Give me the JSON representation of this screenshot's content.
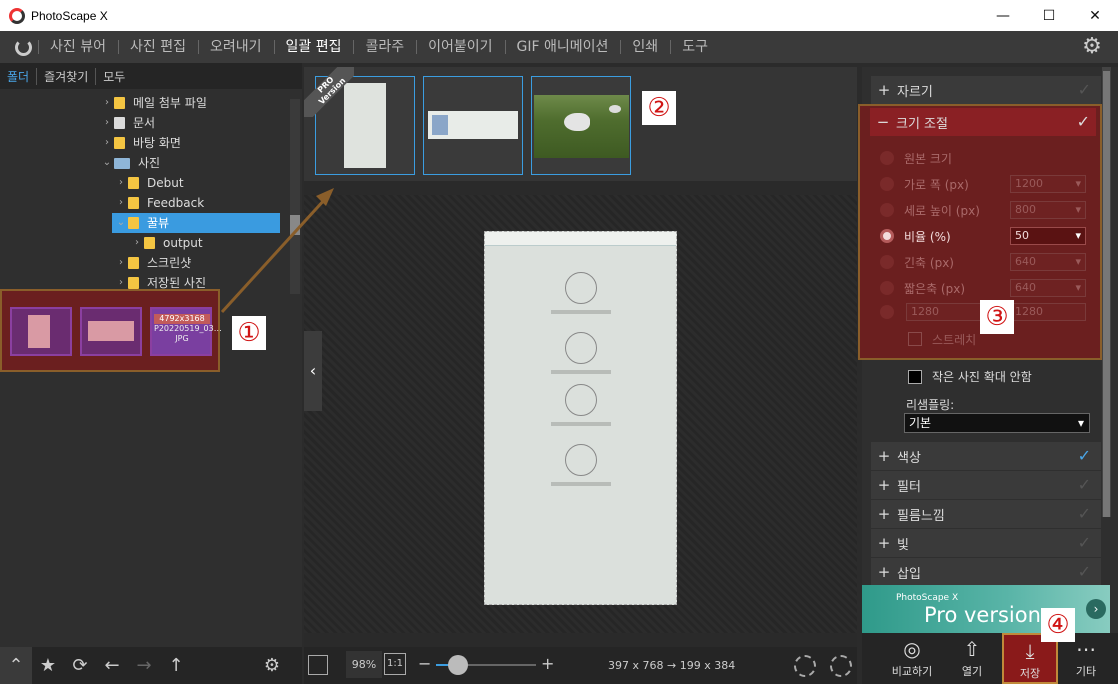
{
  "window": {
    "title": "PhotoScape X",
    "min": "—",
    "max": "☐",
    "close": "✕"
  },
  "menu": {
    "tabs": [
      "사진 뷰어",
      "사진 편집",
      "오려내기",
      "일괄 편집",
      "콜라주",
      "이어붙이기",
      "GIF 애니메이션",
      "인쇄",
      "도구"
    ],
    "active_index": 3
  },
  "left": {
    "subtabs": [
      "폴더",
      "즐겨찾기",
      "모두"
    ],
    "tree": [
      {
        "label": "메일 첨부 파일",
        "type": "folder",
        "level": 0,
        "arrow": "›"
      },
      {
        "label": "문서",
        "type": "doc",
        "level": 0,
        "arrow": "›"
      },
      {
        "label": "바탕 화면",
        "type": "folder",
        "level": 0,
        "arrow": "›"
      },
      {
        "label": "사진",
        "type": "pic",
        "level": 0,
        "arrow": "⌄"
      },
      {
        "label": "Debut",
        "type": "folder",
        "level": 1,
        "arrow": "›"
      },
      {
        "label": "Feedback",
        "type": "folder",
        "level": 1,
        "arrow": "›"
      },
      {
        "label": "꿀뷰",
        "type": "folder",
        "level": 1,
        "arrow": "⌄",
        "selected": true
      },
      {
        "label": "output",
        "type": "folder",
        "level": 2,
        "arrow": "›"
      },
      {
        "label": "스크린샷",
        "type": "folder",
        "level": 1,
        "arrow": "›"
      },
      {
        "label": "저장된 사진",
        "type": "folder",
        "level": 1,
        "arrow": "›"
      }
    ],
    "thumb3_dims": "4792x3168",
    "thumb3_name": "P20220519_03…JPG",
    "bottom_icons": [
      "chevron-up-icon",
      "star-icon",
      "sync-icon",
      "arrow-left-icon",
      "arrow-right-icon",
      "arrow-up-icon",
      "gear-icon"
    ]
  },
  "annotations": {
    "one": "①",
    "two": "②",
    "three": "③",
    "four": "④"
  },
  "center": {
    "pro_ribbon_line1": "PRO",
    "pro_ribbon_line2": "Version",
    "zoom": "98%",
    "one_to_one": "1:1",
    "zoom_minus": "−",
    "zoom_plus": "+",
    "zoom_fraction": 0.22,
    "dimensions": "397 x 768 → 199 x 384",
    "collapse_arrow": "‹"
  },
  "right": {
    "sections_top": [
      {
        "label": "자르기",
        "sign": "+",
        "checked": false
      }
    ],
    "resize": {
      "label": "크기 조절",
      "sign": "−",
      "options": [
        {
          "label": "원본 크기",
          "selected": false,
          "value": ""
        },
        {
          "label": "가로 폭 (px)",
          "selected": false,
          "value": "1200"
        },
        {
          "label": "세로 높이 (px)",
          "selected": false,
          "value": "800"
        },
        {
          "label": "비율 (%)",
          "selected": true,
          "value": "50"
        },
        {
          "label": "긴축 (px)",
          "selected": false,
          "value": "640"
        },
        {
          "label": "짧은축 (px)",
          "selected": false,
          "value": "640"
        }
      ],
      "custom_w": "1280",
      "custom_h": "1280",
      "stretch_label": "스트레치"
    },
    "no_upscale_label": "작은 사진 확대 안함",
    "resample_label": "리샘플링:",
    "resample_value": "기본",
    "sections_bottom": [
      {
        "label": "색상",
        "sign": "+",
        "checked": true
      },
      {
        "label": "필터",
        "sign": "+",
        "checked": false
      },
      {
        "label": "필름느낌",
        "sign": "+",
        "checked": false
      },
      {
        "label": "빛",
        "sign": "+",
        "checked": false
      },
      {
        "label": "삽입",
        "sign": "+",
        "checked": false
      }
    ],
    "banner_line1": "PhotoScape X",
    "banner_line2": "Pro version",
    "banner_go": "›",
    "bottom_buttons": [
      {
        "label": "비교하기",
        "icon": "compare-icon"
      },
      {
        "label": "열기",
        "icon": "open-icon"
      },
      {
        "label": "저장",
        "icon": "save-icon"
      },
      {
        "label": "기타",
        "icon": "more-icon"
      }
    ]
  }
}
